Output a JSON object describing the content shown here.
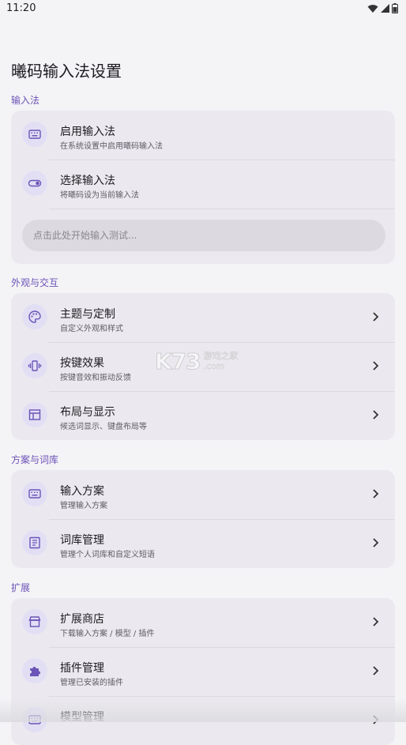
{
  "status_bar": {
    "time": "11:20"
  },
  "page_title": "曦码输入法设置",
  "sections": {
    "input_method": {
      "label": "输入法",
      "items": [
        {
          "title": "启用输入法",
          "subtitle": "在系统设置中启用曦码输入法",
          "icon": "keyboard-icon"
        },
        {
          "title": "选择输入法",
          "subtitle": "将曦码设为当前输入法",
          "icon": "toggle-icon"
        }
      ],
      "test_input_placeholder": "点击此处开始输入测试..."
    },
    "appearance": {
      "label": "外观与交互",
      "items": [
        {
          "title": "主题与定制",
          "subtitle": "自定义外观和样式",
          "icon": "palette-icon"
        },
        {
          "title": "按键效果",
          "subtitle": "按键音效和振动反馈",
          "icon": "vibration-icon"
        },
        {
          "title": "布局与显示",
          "subtitle": "候选词显示、键盘布局等",
          "icon": "layout-icon"
        }
      ]
    },
    "schemes": {
      "label": "方案与词库",
      "items": [
        {
          "title": "输入方案",
          "subtitle": "管理输入方案",
          "icon": "keyboard-icon"
        },
        {
          "title": "词库管理",
          "subtitle": "管理个人词库和自定义短语",
          "icon": "dictionary-icon"
        }
      ]
    },
    "extensions": {
      "label": "扩展",
      "items": [
        {
          "title": "扩展商店",
          "subtitle": "下载输入方案 / 模型 / 插件",
          "icon": "store-icon"
        },
        {
          "title": "插件管理",
          "subtitle": "管理已安装的插件",
          "icon": "puzzle-icon"
        },
        {
          "title": "模型管理",
          "subtitle": "",
          "icon": "keyboard-icon"
        }
      ]
    }
  },
  "watermark": {
    "logo": "K73",
    "line1": "游戏之家",
    "line2": ".com"
  },
  "colors": {
    "accent": "#6b53b7",
    "card": "#ebe9ef",
    "icon_bg": "#e2dff5",
    "background": "#f4f3f6"
  }
}
